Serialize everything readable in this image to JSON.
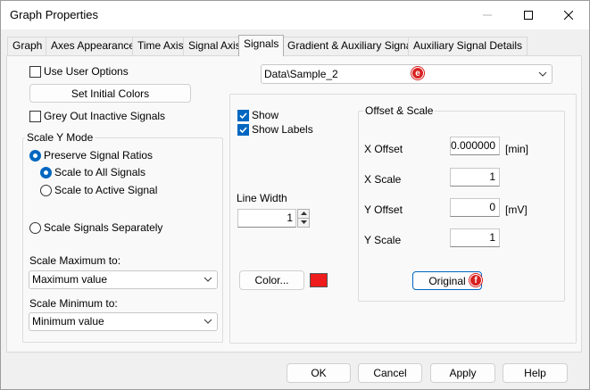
{
  "window": {
    "title": "Graph Properties"
  },
  "tabs": [
    {
      "label": "Graph"
    },
    {
      "label": "Axes Appearance"
    },
    {
      "label": "Time Axis"
    },
    {
      "label": "Signal Axis"
    },
    {
      "label": "Signals",
      "active": true
    },
    {
      "label": "Gradient & Auxiliary Signals"
    },
    {
      "label": "Auxiliary Signal Details"
    }
  ],
  "left": {
    "use_user_options": {
      "label": "Use User Options",
      "checked": false
    },
    "set_initial_colors_label": "Set Initial Colors",
    "grey_out": {
      "label": "Grey Out Inactive Signals",
      "checked": false
    },
    "scale_y_mode": {
      "title": "Scale Y Mode",
      "preserve_ratios": {
        "label": "Preserve Signal Ratios",
        "checked": true
      },
      "scale_all": {
        "label": "Scale to All Signals",
        "checked": true
      },
      "scale_active": {
        "label": "Scale to Active Signal",
        "checked": false
      },
      "scale_separately": {
        "label": "Scale Signals Separately",
        "checked": false
      },
      "scale_max_label": "Scale Maximum to:",
      "scale_max_value": "Maximum value",
      "scale_min_label": "Scale Minimum to:",
      "scale_min_value": "Minimum value"
    }
  },
  "right": {
    "signal_select": {
      "value": "Data\\Sample_2",
      "badge": "e"
    },
    "show": {
      "label": "Show",
      "checked": true
    },
    "show_labels": {
      "label": "Show Labels",
      "checked": true
    },
    "line_width_label": "Line Width",
    "line_width_value": "1",
    "color_button_label": "Color...",
    "color_swatch": "#ee1c1c",
    "offset_scale": {
      "title": "Offset & Scale",
      "x_offset": {
        "label": "X Offset",
        "value": "0.000000",
        "unit": "[min]"
      },
      "x_scale": {
        "label": "X Scale",
        "value": "1"
      },
      "y_offset": {
        "label": "Y Offset",
        "value": "0",
        "unit": "[mV]"
      },
      "y_scale": {
        "label": "Y Scale",
        "value": "1"
      },
      "original_label": "Original",
      "original_badge": "f"
    }
  },
  "footer": {
    "ok": "OK",
    "cancel": "Cancel",
    "apply": "Apply",
    "help": "Help"
  },
  "colors": {
    "accent": "#0067c0",
    "badge": "#d92020"
  }
}
